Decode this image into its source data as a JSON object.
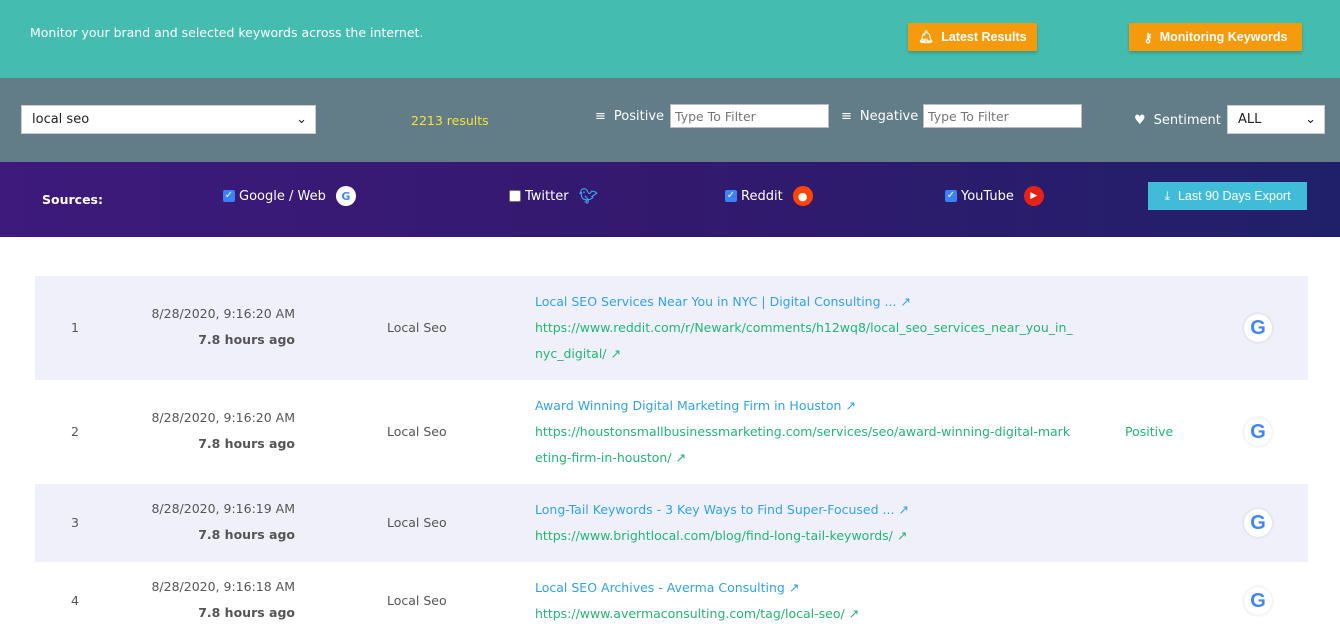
{
  "header": {
    "tagline": "Monitor your brand and selected keywords across the internet.",
    "latest_results": "Latest Results",
    "monitoring_keywords": "Monitoring Keywords"
  },
  "filters": {
    "keyword": "local seo",
    "result_count": "2213",
    "result_suffix": "results",
    "positive_label": "Positive",
    "positive_placeholder": "Type To Filter",
    "negative_label": "Negative",
    "negative_placeholder": "Type To Filter",
    "sentiment_label": "Sentiment",
    "sentiment_value": "ALL"
  },
  "sources": {
    "label": "Sources:",
    "items": [
      {
        "label": "Google / Web",
        "checked": true
      },
      {
        "label": "Twitter",
        "checked": false
      },
      {
        "label": "Reddit",
        "checked": true
      },
      {
        "label": "YouTube",
        "checked": true
      }
    ],
    "export": "Last 90 Days Export"
  },
  "colors": {
    "header": "#44bcb0",
    "filter_bar": "#627c88",
    "accent_orange": "#f59a0a",
    "link": "#2fa2e8",
    "url": "#22b573"
  },
  "results": [
    {
      "index": "1",
      "date": "8/28/2020, 9:16:20 AM",
      "ago": "7.8 hours ago",
      "keyword": "Local Seo",
      "title": "Local SEO Services Near You in NYC | Digital Consulting ...",
      "url": "https://www.reddit.com/r/Newark/comments/h12wq8/local_seo_services_near_you_in_nyc_digital/",
      "sentiment": "",
      "source_icon": "google-icon"
    },
    {
      "index": "2",
      "date": "8/28/2020, 9:16:20 AM",
      "ago": "7.8 hours ago",
      "keyword": "Local Seo",
      "title": "Award Winning Digital Marketing Firm in Houston",
      "url": "https://houstonsmallbusinessmarketing.com/services/seo/award-winning-digital-marketing-firm-in-houston/",
      "sentiment": "Positive",
      "source_icon": "google-icon"
    },
    {
      "index": "3",
      "date": "8/28/2020, 9:16:19 AM",
      "ago": "7.8 hours ago",
      "keyword": "Local Seo",
      "title": "Long-Tail Keywords - 3 Key Ways to Find Super-Focused ...",
      "url": "https://www.brightlocal.com/blog/find-long-tail-keywords/",
      "sentiment": "",
      "source_icon": "google-icon"
    },
    {
      "index": "4",
      "date": "8/28/2020, 9:16:18 AM",
      "ago": "7.8 hours ago",
      "keyword": "Local Seo",
      "title": "Local SEO Archives - Averma Consulting",
      "url": "https://www.avermaconsulting.com/tag/local-seo/",
      "sentiment": "",
      "source_icon": "google-icon"
    }
  ]
}
